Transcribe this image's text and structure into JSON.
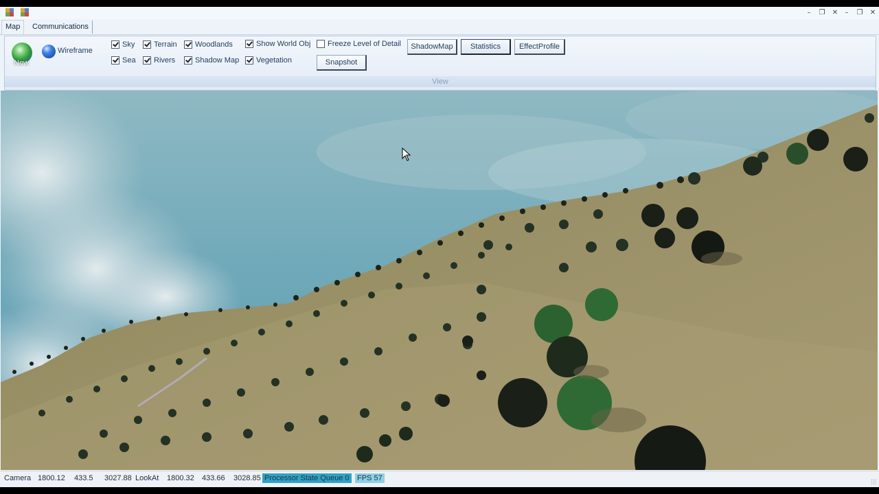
{
  "window": {
    "controls_outer": [
      "–",
      "❐",
      "✕"
    ],
    "controls_inner": [
      "–",
      "❐",
      "✕"
    ]
  },
  "tabs": [
    {
      "label": "Map",
      "active": true
    },
    {
      "label": "Communications",
      "active": false
    }
  ],
  "ribbon": {
    "new_label": "New",
    "wireframe_label": "Wireframe",
    "checkboxes": [
      {
        "label": "Sky",
        "checked": true
      },
      {
        "label": "Sea",
        "checked": true
      },
      {
        "label": "Terrain",
        "checked": true
      },
      {
        "label": "Rivers",
        "checked": true
      },
      {
        "label": "Woodlands",
        "checked": true
      },
      {
        "label": "Shadow Map",
        "checked": true
      },
      {
        "label": "Show World Obj",
        "checked": true
      },
      {
        "label": "Vegetation",
        "checked": true
      },
      {
        "label": "Freeze Level of Detail",
        "checked": false
      }
    ],
    "buttons": {
      "snapshot": "Snapshot",
      "shadowmap": "ShadowMap",
      "statistics": "Statistics",
      "effectprofile": "EffectProfile"
    },
    "group_label": "View"
  },
  "status": {
    "camera_label": "Camera",
    "camera_x": "1800.12",
    "camera_y": "433.5",
    "camera_z": "3027.88",
    "lookat_label": "LookAt",
    "lookat_x": "1800.32",
    "lookat_y": "433.66",
    "lookat_z": "3028.85",
    "processor_state": "Processor State  Queue 0",
    "fps": "FPS 57"
  },
  "colors": {
    "sky_top": "#8fb9c3",
    "sky_bottom": "#63a0b4",
    "terrain": "#948c61",
    "processor_badge": "#31a3c4",
    "fps_badge": "#8fd0e4"
  }
}
